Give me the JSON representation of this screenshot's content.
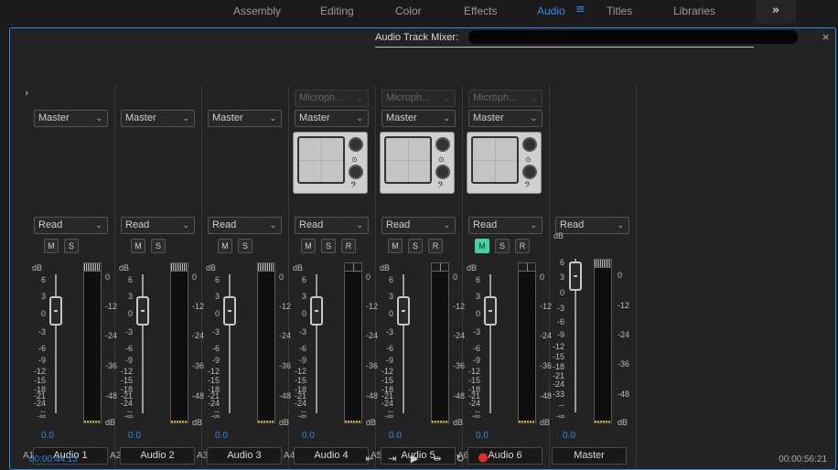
{
  "workspaces": [
    {
      "label": "Assembly",
      "active": false
    },
    {
      "label": "Editing",
      "active": false
    },
    {
      "label": "Color",
      "active": false
    },
    {
      "label": "Effects",
      "active": false
    },
    {
      "label": "Audio",
      "active": true
    },
    {
      "label": "Titles",
      "active": false
    },
    {
      "label": "Libraries",
      "active": false
    }
  ],
  "workspace_menu_icon": "hamburger-icon",
  "more_label": "»",
  "panel": {
    "title": "Audio Track Mixer:",
    "close_label": "×",
    "collapse_label": "›"
  },
  "left_scale": [
    "dB",
    "6",
    "3",
    "0",
    "-3",
    "-6",
    "-9",
    "-12",
    "-15",
    "-18",
    "-21",
    "-24",
    "--",
    "-∞"
  ],
  "master_left_scale": [
    "dB",
    "6",
    "3",
    "0",
    "-3",
    "-6",
    "-9",
    "-12",
    "-15",
    "-18",
    "-21",
    "-24",
    "-33",
    "--",
    "-∞"
  ],
  "right_scale": [
    "0",
    "-12",
    "-24",
    "-36",
    "-48",
    "dB"
  ],
  "tracks": [
    {
      "id": "A1",
      "name": "Audio 1",
      "output": "Master",
      "mode": "Read",
      "input": "",
      "buttons": [
        "M",
        "S"
      ],
      "active": [],
      "volume": "0.0",
      "panner": false
    },
    {
      "id": "A2",
      "name": "Audio 2",
      "output": "Master",
      "mode": "Read",
      "input": "",
      "buttons": [
        "M",
        "S"
      ],
      "active": [],
      "volume": "0.0",
      "panner": false
    },
    {
      "id": "A3",
      "name": "Audio 3",
      "output": "Master",
      "mode": "Read",
      "input": "",
      "buttons": [
        "M",
        "S"
      ],
      "active": [],
      "volume": "0.0",
      "panner": false
    },
    {
      "id": "A4",
      "name": "Audio 4",
      "output": "Master",
      "mode": "Read",
      "input": "Microph...",
      "buttons": [
        "M",
        "S",
        "R"
      ],
      "active": [],
      "volume": "0.0",
      "panner": true
    },
    {
      "id": "A5",
      "name": "Audio 5",
      "output": "Master",
      "mode": "Read",
      "input": "Microph...",
      "buttons": [
        "M",
        "S",
        "R"
      ],
      "active": [],
      "volume": "0.0",
      "panner": true
    },
    {
      "id": "A6",
      "name": "Audio 6",
      "output": "Master",
      "mode": "Read",
      "input": "Microph...",
      "buttons": [
        "M",
        "S",
        "R"
      ],
      "active": [
        "M"
      ],
      "volume": "0.0",
      "panner": true
    }
  ],
  "master": {
    "name": "Master",
    "mode": "Read",
    "volume": "0.0"
  },
  "transport": {
    "current_time": "00:00:44:13",
    "duration": "00:00:56:21",
    "buttons": [
      {
        "name": "go-to-in-icon",
        "glyph": "⇤"
      },
      {
        "name": "go-to-out-icon",
        "glyph": "⇥"
      },
      {
        "name": "play-icon",
        "glyph": "▶"
      },
      {
        "name": "play-in-to-out-icon",
        "glyph": "⇹"
      },
      {
        "name": "loop-icon",
        "glyph": "↻"
      },
      {
        "name": "record-icon",
        "glyph": "●"
      }
    ]
  },
  "colors": {
    "accent": "#2d8ceb",
    "mute_on": "#3ed5a0",
    "record": "#e02c2c"
  }
}
